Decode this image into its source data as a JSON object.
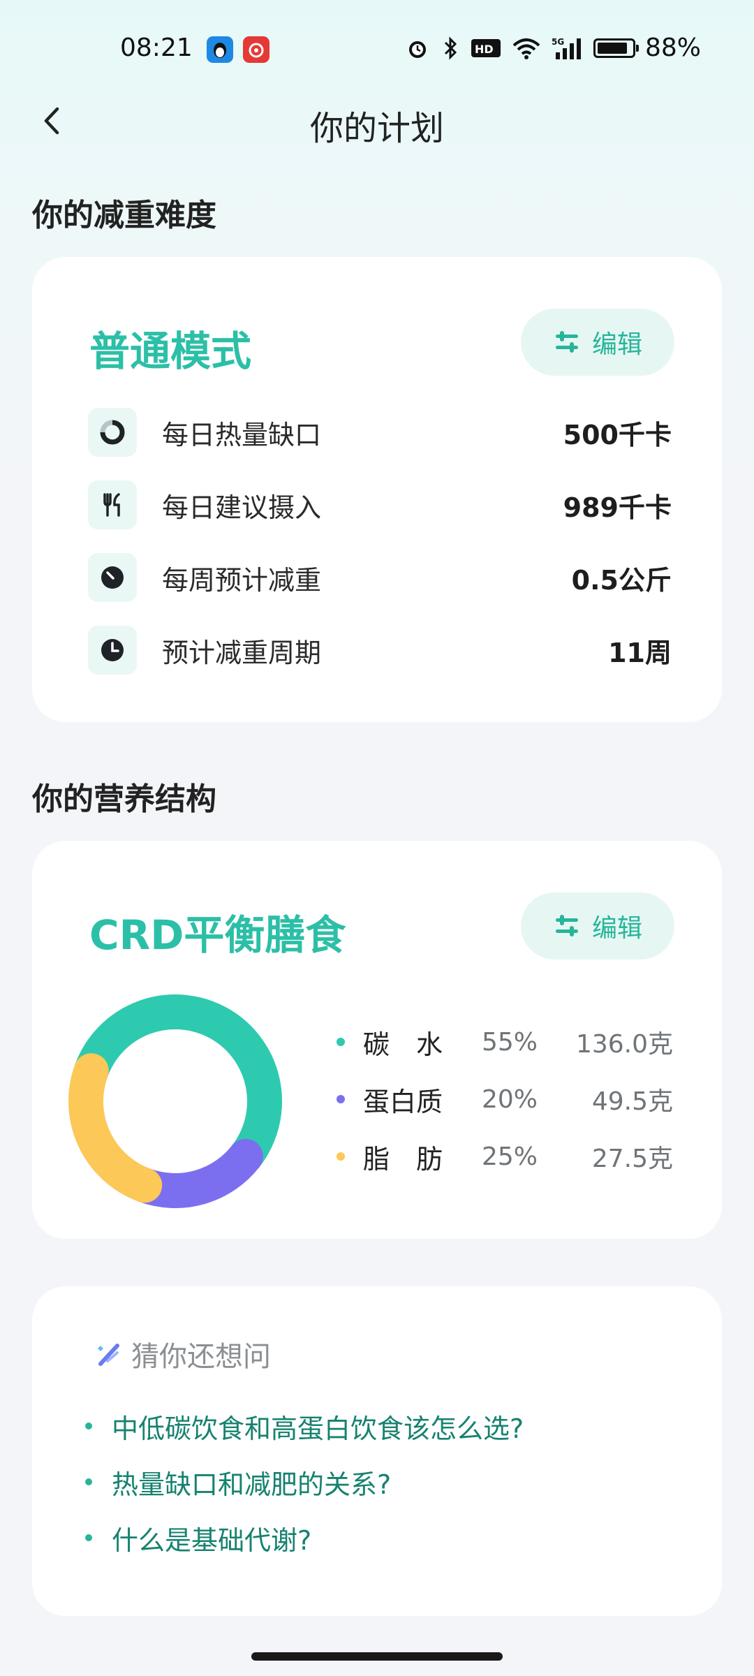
{
  "status": {
    "time": "08:21",
    "battery": "88%",
    "battery_level": 0.88
  },
  "header": {
    "title": "你的计划"
  },
  "difficulty": {
    "section_title": "你的减重难度",
    "mode": "普通模式",
    "edit_label": "编辑",
    "metrics": [
      {
        "label": "每日热量缺口",
        "value": "500千卡",
        "icon": "ring-icon"
      },
      {
        "label": "每日建议摄入",
        "value": "989千卡",
        "icon": "fork-knife-icon"
      },
      {
        "label": "每周预计减重",
        "value": "0.5公斤",
        "icon": "gauge-icon"
      },
      {
        "label": "预计减重周期",
        "value": "11周",
        "icon": "clock-icon"
      }
    ]
  },
  "nutrition": {
    "section_title": "你的营养结构",
    "diet": "CRD平衡膳食",
    "edit_label": "编辑",
    "items": [
      {
        "name": "碳　水",
        "pct": "55%",
        "amount": "136.0克",
        "color": "#2ecab0"
      },
      {
        "name": "蛋白质",
        "pct": "20%",
        "amount": "49.5克",
        "color": "#7b6ff0"
      },
      {
        "name": "脂　肪",
        "pct": "25%",
        "amount": "27.5克",
        "color": "#fcc858"
      }
    ]
  },
  "suggest": {
    "title": "猜你还想问",
    "questions": [
      "中低碳饮食和高蛋白饮食该怎么选?",
      "热量缺口和减肥的关系?",
      "什么是基础代谢?"
    ]
  }
}
